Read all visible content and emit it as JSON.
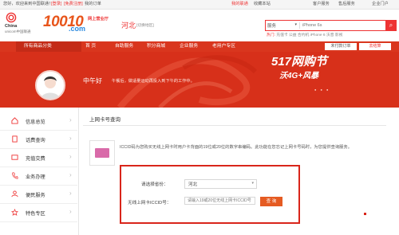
{
  "topbar": {
    "welcome": "您好，欢迎来到中国联通！",
    "login": "[登录]",
    "register": "[免费注册]",
    "my_orders": "我的订单",
    "my_account": "我的联通",
    "favorites": "收藏本站",
    "customer_service": "客户服务",
    "aftersale": "售后服务",
    "enterprise": "企业门户"
  },
  "header": {
    "logo_cn": "China",
    "logo_en": "unicom中国联通",
    "brand_number": "10010",
    "brand_com": ".com",
    "brand_sub": "网上营业厅",
    "brand_sub2": "",
    "region": "河北",
    "region_switch": "[切换地区]",
    "search_category": "服务",
    "search_placeholder": "iPhone 6s",
    "hot_label": "热门:",
    "hot_words": "充值卡 公益 合约机 iPhone 6 沃音 影视"
  },
  "nav": {
    "all_categories": "所有商品分类",
    "items": [
      "首 页",
      "自助服务",
      "积分商城",
      "企业服务",
      "老用户专区"
    ],
    "store_select": "未付款订单",
    "cart": "去结算"
  },
  "banner": {
    "greeting": "中午好",
    "greeting_sub": "午餐后，做适量运动再投入到下午的工作中。",
    "promo_title": "517网购节",
    "promo_sub": "沃4G+风暴"
  },
  "sidebar": {
    "items": [
      {
        "label": "信息总览",
        "icon": "home-icon"
      },
      {
        "label": "话费查询",
        "icon": "document-icon"
      },
      {
        "label": "充值交费",
        "icon": "wallet-icon"
      },
      {
        "label": "业务办理",
        "icon": "phone-icon"
      },
      {
        "label": "便民服务",
        "icon": "people-icon"
      },
      {
        "label": "特色专区",
        "icon": "star-icon"
      }
    ]
  },
  "main": {
    "breadcrumb": "上网卡号查询",
    "info_text": "ICCID码为您购买无线上网卡时用户卡背面的19位或20位的数字串编码。此功能在您忘记上网卡号码时，为您提供查询服务。",
    "province_label": "请选择省份：",
    "province_value": "河北",
    "iccid_label": "无线上网卡ICCID号：",
    "iccid_placeholder": "请输入19或20位无线上网卡ICCID号",
    "query_button": "查 询"
  },
  "colors": {
    "brand_red": "#d9361e",
    "accent_orange": "#e55b22"
  }
}
